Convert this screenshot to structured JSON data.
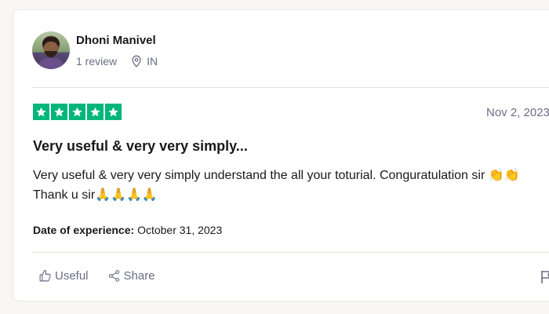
{
  "reviewer": {
    "name": "Dhoni Manivel",
    "review_count": "1 review",
    "country": "IN"
  },
  "review": {
    "rating": 5,
    "max_rating": 5,
    "star_color": "#00b67a",
    "date": "Nov 2, 2023",
    "title": "Very useful & very very simply...",
    "text": "Very useful & very very simply understand the all your toturial. Conguratulation sir 👏👏 Thank u sir🙏🙏🙏🙏",
    "experience_label": "Date of experience:",
    "experience_date": "October 31, 2023"
  },
  "actions": {
    "useful_label": "Useful",
    "share_label": "Share"
  },
  "icons": {
    "avatar": "avatar",
    "location": "location-pin-icon",
    "thumbs_up": "thumbs-up-icon",
    "share": "share-icon",
    "flag": "flag-icon",
    "star": "star-icon"
  }
}
